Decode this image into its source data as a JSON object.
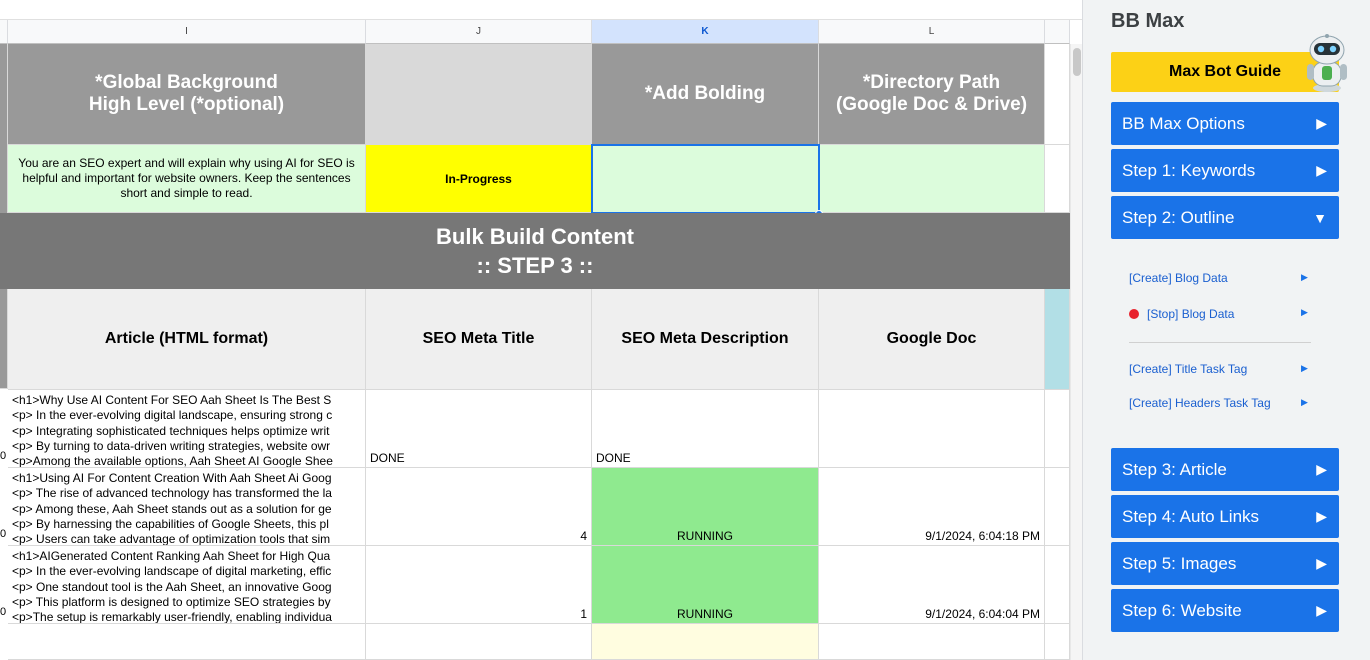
{
  "sheet": {
    "columns": [
      "I",
      "J",
      "K",
      "L"
    ],
    "headers": {
      "global_background_1": "*Global Background",
      "global_background_2": "High Level (*optional)",
      "add_bolding": "*Add Bolding",
      "directory_path_1": "*Directory Path",
      "directory_path_2": "(Google Doc & Drive)"
    },
    "config_row": {
      "prompt": "You are an SEO expert and will explain why using AI for SEO is helpful and important for website owners. Keep the sentences short and simple to read.",
      "status": "In-Progress",
      "bolding": "",
      "directory": ""
    },
    "band": {
      "title": "Bulk Build Content",
      "step": ":: STEP 3 ::"
    },
    "subheaders": {
      "article": "Article (HTML format)",
      "meta_title": "SEO Meta Title",
      "meta_description": "SEO Meta Description",
      "google_doc": "Google Doc"
    },
    "row_stub": "0",
    "rows": [
      {
        "article_lines": [
          "<h1>Why Use AI Content For SEO Aah Sheet Is The Best S",
          "<p> In the ever-evolving digital landscape, ensuring strong c",
          "<p> Integrating sophisticated techniques helps optimize writ",
          "<p> By turning to data-driven writing strategies, website owr",
          "<p>Among the available options, Aah Sheet AI Google Shee"
        ],
        "meta_title": "DONE",
        "meta_description": "DONE",
        "google_doc": ""
      },
      {
        "article_lines": [
          "<h1>Using AI For Content Creation With Aah Sheet Ai Goog",
          "<p> The rise of advanced technology has transformed the la",
          "<p> Among these, Aah Sheet stands out as a solution for ge",
          "<p> By harnessing the capabilities of Google Sheets, this pl",
          "<p> Users can take advantage of optimization tools that sim"
        ],
        "meta_title": "4",
        "meta_description": "RUNNING",
        "google_doc": "9/1/2024, 6:04:18 PM"
      },
      {
        "article_lines": [
          "<h1>AIGenerated Content Ranking Aah Sheet for High Qua",
          "<p> In the ever-evolving landscape of digital marketing, effic",
          "<p> One standout tool is the Aah Sheet, an innovative Goog",
          "<p> This platform is designed to optimize SEO strategies by",
          "<p>The setup is remarkably user-friendly, enabling individua"
        ],
        "meta_title": "1",
        "meta_description": "RUNNING",
        "google_doc": "9/1/2024, 6:04:04 PM"
      }
    ],
    "colors": {
      "header_grey": "#999999",
      "band_grey": "#777777",
      "light_green": "#dcfcdc",
      "yellow": "#ffff00",
      "running_green": "#8fea8f",
      "light_yellow": "#fffde0",
      "teal": "#b2dfe6"
    }
  },
  "panel": {
    "title": "BB Max",
    "guide_button": "Max Bot Guide",
    "robot_icon": "robot-icon",
    "steps": [
      {
        "label": "BB Max Options",
        "arrow": "▶"
      },
      {
        "label": "Step 1: Keywords",
        "arrow": "▶"
      },
      {
        "label": "Step 2: Outline",
        "arrow": "▼"
      }
    ],
    "sub_items": [
      {
        "label": "[Create] Blog Data",
        "arrow": "▶"
      },
      {
        "label": "[Stop] Blog Data",
        "arrow": "▶"
      },
      {
        "label": "[Create] Title Task Tag",
        "arrow": "▶"
      },
      {
        "label": "[Create] Headers Task Tag",
        "arrow": "▶"
      }
    ],
    "lower_steps": [
      {
        "label": "Step 3: Article",
        "arrow": "▶"
      },
      {
        "label": "Step 4: Auto Links",
        "arrow": "▶"
      },
      {
        "label": "Step 5: Images",
        "arrow": "▶"
      },
      {
        "label": "Step 6: Website",
        "arrow": "▶"
      }
    ],
    "colors": {
      "button_blue": "#1a73e8",
      "guide_yellow": "#fcd116"
    }
  }
}
